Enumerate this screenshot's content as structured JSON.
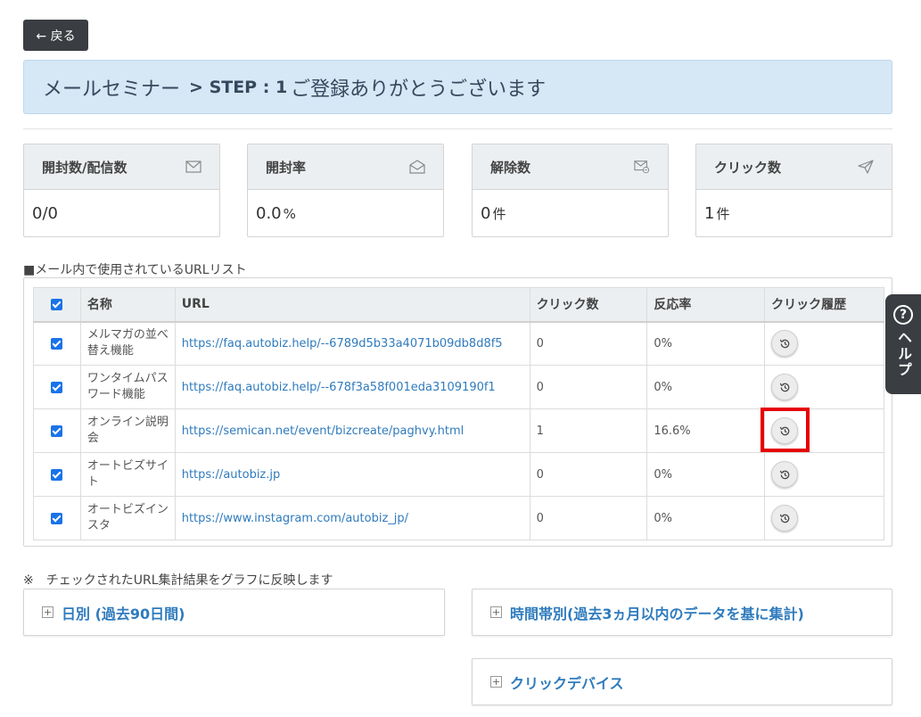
{
  "back_label": "← 戻る",
  "title": {
    "prefix": "メールセミナー",
    "separator": ">",
    "step": "STEP : 1",
    "subject": "ご登録ありがとうございます"
  },
  "stats": [
    {
      "label": "開封数/配信数",
      "value": "0/0",
      "unit": "",
      "icon": "mail-icon"
    },
    {
      "label": "開封率",
      "value": "0.0",
      "unit": "%",
      "icon": "mail-open-icon"
    },
    {
      "label": "解除数",
      "value": "0",
      "unit": "件",
      "icon": "mail-minus-icon"
    },
    {
      "label": "クリック数",
      "value": "1",
      "unit": " 件",
      "icon": "send-icon"
    }
  ],
  "url_list_label": "■メール内で使用されているURLリスト",
  "table": {
    "headers": {
      "name": "名称",
      "url": "URL",
      "clicks": "クリック数",
      "rate": "反応率",
      "history": "クリック履歴"
    },
    "rows": [
      {
        "name": "メルマガの並べ替え機能",
        "url": "https://faq.autobiz.help/--6789d5b33a4071b09db8d8f5",
        "clicks": "0",
        "rate": "0%"
      },
      {
        "name": "ワンタイムパスワード機能",
        "url": "https://faq.autobiz.help/--678f3a58f001eda3109190f1",
        "clicks": "0",
        "rate": "0%"
      },
      {
        "name": "オンライン説明会",
        "url": "https://semican.net/event/bizcreate/paghvy.html",
        "clicks": "1",
        "rate": "16.6%"
      },
      {
        "name": "オートビズサイト",
        "url": "https://autobiz.jp",
        "clicks": "0",
        "rate": "0%"
      },
      {
        "name": "オートビズインスタ",
        "url": "https://www.instagram.com/autobiz_jp/",
        "clicks": "0",
        "rate": "0%"
      }
    ]
  },
  "note": "※　チェックされたURL集計結果をグラフに反映します",
  "panels": {
    "daily": "日別 (過去90日間)",
    "hourly": "時間帯別(過去3ヵ月以内のデータを基に集計)",
    "device": "クリックデバイス"
  },
  "help": {
    "icon": "?",
    "label": "ヘルプ"
  },
  "colors": {
    "accent": "#2f7bbd",
    "title_bg": "#d6e7f5",
    "highlight": "#e60000",
    "dark": "#3a3d41"
  }
}
